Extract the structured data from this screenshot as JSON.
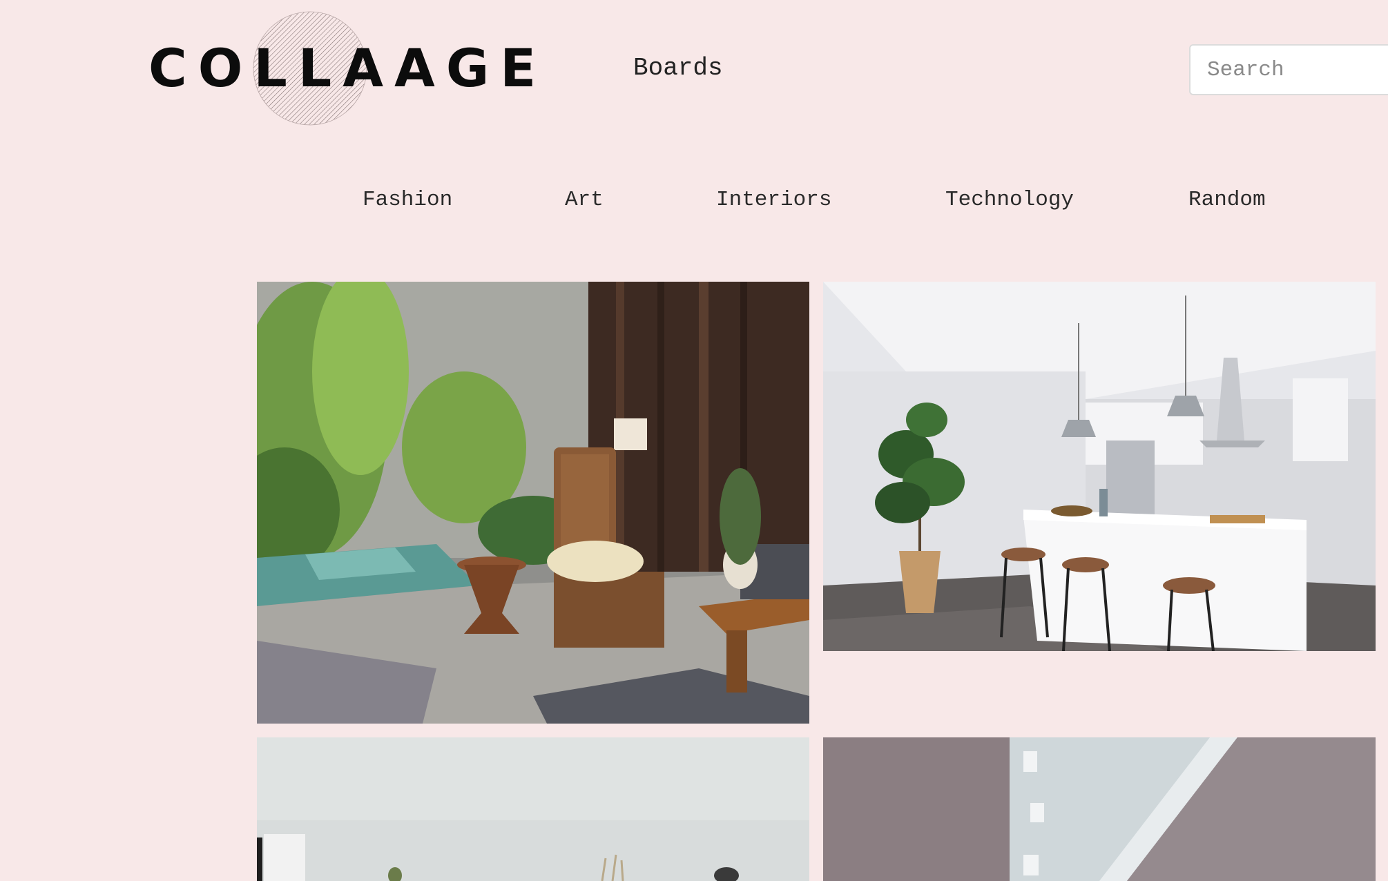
{
  "header": {
    "logo_text": "COLLAAGE",
    "boards_label": "Boards",
    "search_placeholder": "Search"
  },
  "categories": [
    {
      "label": "Fashion"
    },
    {
      "label": "Art"
    },
    {
      "label": "Interiors"
    },
    {
      "label": "Technology"
    },
    {
      "label": "Random"
    }
  ],
  "gallery": {
    "images": [
      {
        "alt": "Living room with pool and rattan chair"
      },
      {
        "alt": "White kitchen with island and stools"
      },
      {
        "alt": "Bright living room"
      },
      {
        "alt": "Stairway interior"
      }
    ]
  },
  "colors": {
    "background": "#f8e8e8",
    "logo": "#0c0c0c"
  }
}
